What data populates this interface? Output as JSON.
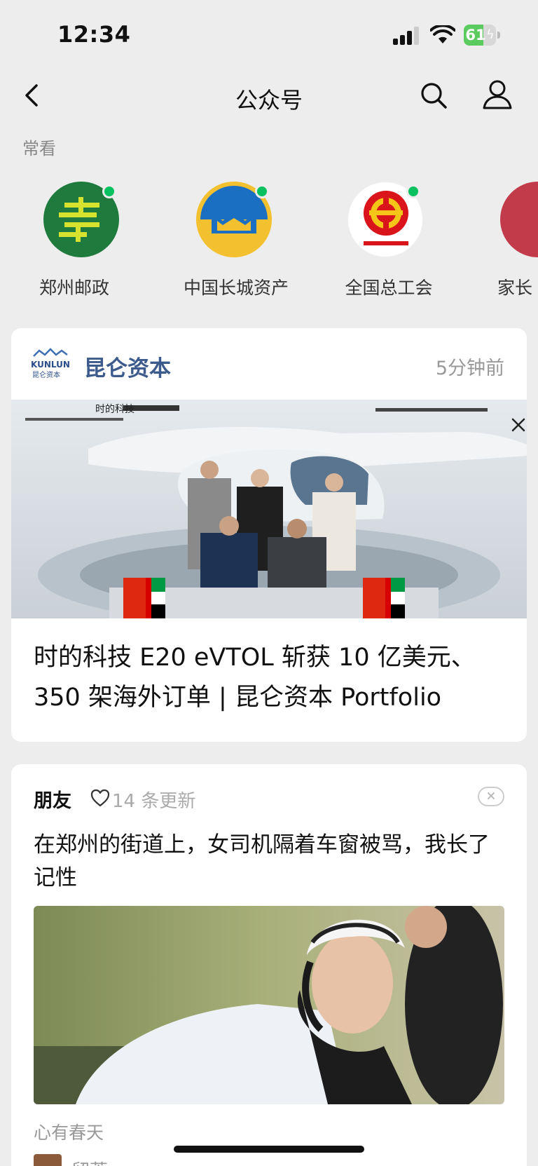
{
  "status_bar": {
    "time": "12:34",
    "battery_pct": "61",
    "battery_level": 0.61
  },
  "nav": {
    "title": "公众号"
  },
  "frequent": {
    "label": "常看",
    "accounts": [
      {
        "name": "郑州邮政",
        "unread": true
      },
      {
        "name": "中国长城资产",
        "unread": true
      },
      {
        "name": "全国总工会",
        "unread": true
      },
      {
        "name": "家长",
        "unread": false
      }
    ]
  },
  "article_card": {
    "logo_text": "KUNLUN",
    "logo_sub": "昆仑资本",
    "account": "昆仑资本",
    "time_ago": "5分钟前",
    "image_label": "时的科技",
    "headline": "时的科技 E20 eVTOL 斩获 10 亿美元、350 架海外订单 | 昆仑资本 Portfolio"
  },
  "friends_card": {
    "label": "朋友",
    "updates": "14 条更新",
    "title": "在郑州的街道上，女司机隔着车窗被骂，我长了记性",
    "source": "心有春天",
    "sub_name": "留萱"
  },
  "colors": {
    "accent_green": "#07c160",
    "account_blue": "#3d5a8c",
    "background": "#ededed"
  }
}
